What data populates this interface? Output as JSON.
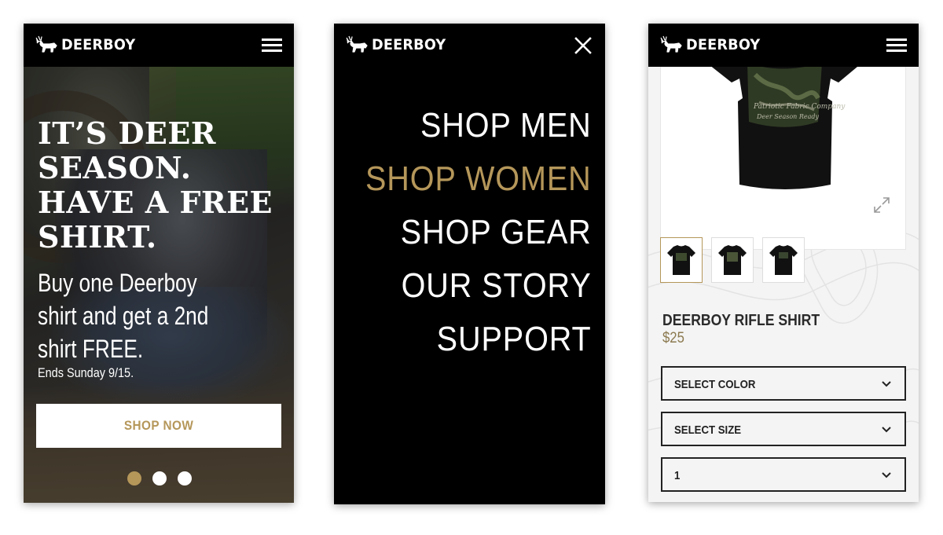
{
  "brand": {
    "name": "DEERBOY",
    "accent_color": "#b5975a",
    "header_color": "#000000"
  },
  "hero": {
    "title_lines": [
      "IT’S DEER",
      "SEASON.",
      "HAVE A FREE",
      "SHIRT."
    ],
    "subtitle_lines": [
      "Buy one Deerboy",
      "shirt and get a 2nd",
      "shirt FREE."
    ],
    "ends": "Ends Sunday 9/15.",
    "cta_label": "SHOP NOW",
    "slides": [
      {
        "active": true
      },
      {
        "active": false
      },
      {
        "active": false
      }
    ]
  },
  "menu": {
    "items": [
      {
        "label": "SHOP MEN",
        "active": false
      },
      {
        "label": "SHOP WOMEN",
        "active": true
      },
      {
        "label": "SHOP GEAR",
        "active": false
      },
      {
        "label": "OUR STORY",
        "active": false
      },
      {
        "label": "SUPPORT",
        "active": false
      }
    ]
  },
  "product": {
    "title": "DEERBOY RIFLE SHIRT",
    "price": "$25",
    "thumbnails": [
      {
        "active": true
      },
      {
        "active": false
      },
      {
        "active": false
      }
    ],
    "selects": [
      {
        "label": "SELECT COLOR"
      },
      {
        "label": "SELECT SIZE"
      },
      {
        "label": "1"
      }
    ]
  },
  "icons": {
    "logo": "deer-logo-icon",
    "menu": "hamburger-menu-icon",
    "close": "close-icon",
    "expand": "expand-icon",
    "chevron": "chevron-down-icon"
  }
}
